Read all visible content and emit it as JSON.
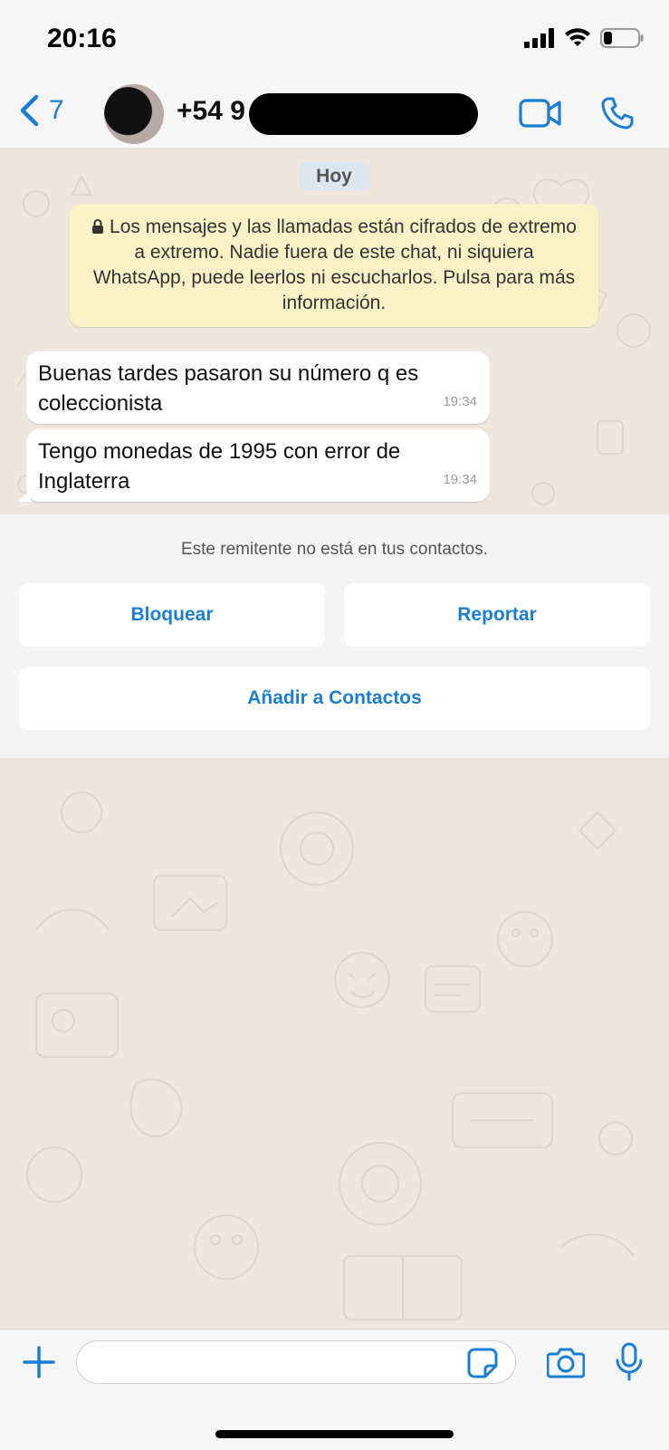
{
  "status_bar": {
    "time": "20:16",
    "battery_level": 0.25
  },
  "header": {
    "back_count": "7",
    "contact_name": "+54 9",
    "icons": [
      "chevron-left-icon",
      "video-call-icon",
      "phone-call-icon"
    ]
  },
  "chat": {
    "day_label": "Hoy",
    "encryption_notice": "Los mensajes y las llamadas están cifrados de extremo a extremo. Nadie fuera de este chat, ni siquiera WhatsApp, puede leerlos ni escucharlos. Pulsa para más información.",
    "messages": [
      {
        "text": "Buenas tardes pasaron su número q es coleccionista",
        "time": "19:34"
      },
      {
        "text": "Tengo monedas de 1995  con error de Inglaterra",
        "time": "19:34"
      }
    ]
  },
  "sender_panel": {
    "note": "Este remitente no está en tus contactos.",
    "block_label": "Bloquear",
    "report_label": "Reportar",
    "add_contact_label": "Añadir a Contactos"
  },
  "input_bar": {
    "placeholder": ""
  },
  "colors": {
    "accent": "#1a7fd4",
    "chat_bg": "#efe7de",
    "notice_bg": "#fbf1c6",
    "bubble_bg": "#ffffff"
  }
}
